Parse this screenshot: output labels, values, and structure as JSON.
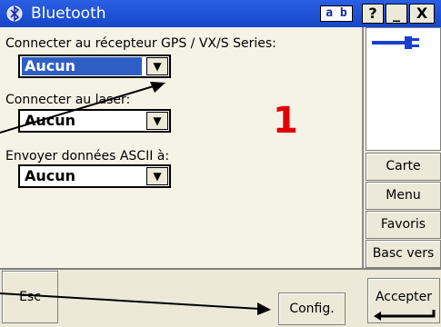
{
  "titlebar": {
    "icon": "bluetooth-icon",
    "title": "Bluetooth",
    "input_mode": "a b",
    "help": "?",
    "minimize": "_",
    "close": "X"
  },
  "main": {
    "fields": [
      {
        "label": "Connecter au récepteur GPS / VX/S Series:",
        "value": "Aucun",
        "selected": true
      },
      {
        "label": "Connecter au laser:",
        "value": "Aucun",
        "selected": false
      },
      {
        "label": "Envoyer données ASCII à:",
        "value": "Aucun",
        "selected": false
      }
    ],
    "annotation": "1"
  },
  "sidebar": {
    "status_icon": "plug-connector-icon",
    "buttons": [
      "Carte",
      "Menu",
      "Favoris",
      "Basc vers"
    ]
  },
  "bottombar": {
    "esc": "Esc",
    "config": "Config.",
    "accept": "Accepter"
  },
  "colors": {
    "titlebar": "#1f4fd8",
    "selection": "#2f5ec4",
    "annotation": "#e00000",
    "plug": "#1a3fd0"
  }
}
